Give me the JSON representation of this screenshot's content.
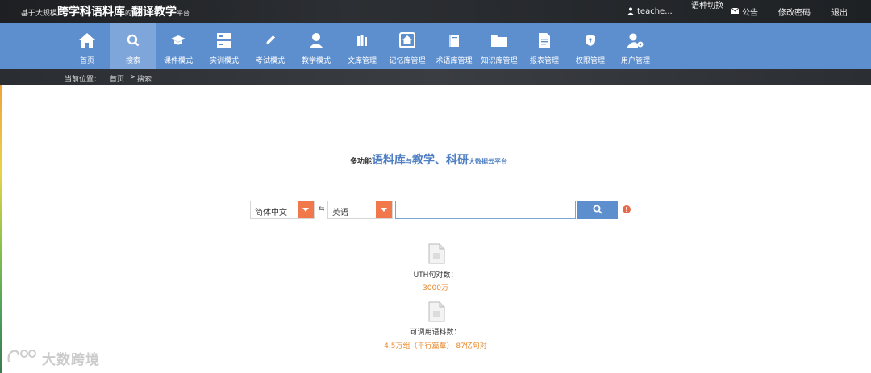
{
  "header": {
    "brand_prefix": "基于大规模",
    "brand_main1": "跨学科语料库",
    "brand_connector": "的",
    "brand_main2": "翻译教学",
    "brand_suffix": "平台",
    "user_label": "teache...",
    "lang_switch_label": "语种切换",
    "announce_label": "公告",
    "change_password_label": "修改密码",
    "logout_label": "退出"
  },
  "nav": {
    "items": [
      {
        "label": "首页",
        "icon": "home-icon"
      },
      {
        "label": "搜索",
        "icon": "search-icon"
      },
      {
        "label": "课件模式",
        "icon": "graduation-cap-icon"
      },
      {
        "label": "实训模式",
        "icon": "server-icon"
      },
      {
        "label": "考试模式",
        "icon": "pencil-icon"
      },
      {
        "label": "教学模式",
        "icon": "user-icon"
      },
      {
        "label": "文库管理",
        "icon": "books-icon"
      },
      {
        "label": "记忆库管理",
        "icon": "home-box-icon"
      },
      {
        "label": "术语库管理",
        "icon": "book-icon"
      },
      {
        "label": "知识库管理",
        "icon": "folder-icon"
      },
      {
        "label": "报表管理",
        "icon": "report-icon"
      },
      {
        "label": "权限管理",
        "icon": "shield-icon"
      },
      {
        "label": "用户管理",
        "icon": "user-gear-icon"
      }
    ],
    "active_index": 1
  },
  "breadcrumb": {
    "prefix": "当前位置：",
    "home": "首页",
    "separator": ">",
    "current": "搜索"
  },
  "slogan": {
    "part1": "多功能",
    "part2": "语料库",
    "part3": "与",
    "part4": "教学、科研",
    "part5": "大数据云平台"
  },
  "search": {
    "source_lang": "简体中文",
    "swap_symbol": "⇆",
    "target_lang": "英语",
    "query": "",
    "placeholder": ""
  },
  "stats": {
    "sentence_pairs_label": "UTH句对数：",
    "sentence_pairs_value": "3000万",
    "corpus_label": "可调用语料数：",
    "corpus_value": "4.5万组（平行篇章） 87亿句对"
  },
  "watermark": {
    "text": "大数跨境"
  },
  "colors": {
    "nav_blue": "#5d8fcf",
    "nav_active": "#7ea6db",
    "accent_orange": "#f0784a",
    "value_orange": "#e88a2e",
    "slogan_blue": "#4f7fc2"
  }
}
